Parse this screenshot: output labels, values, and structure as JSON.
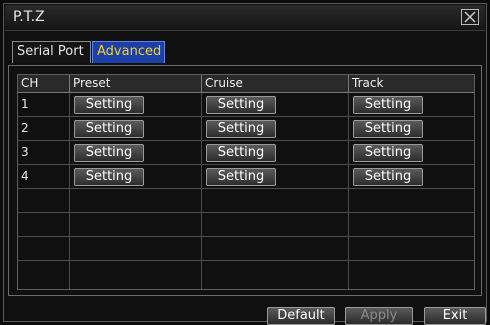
{
  "window": {
    "title": "P.T.Z"
  },
  "tabs": [
    {
      "label": "Serial Port",
      "active": false
    },
    {
      "label": "Advanced",
      "active": true
    }
  ],
  "table": {
    "headers": [
      "CH",
      "Preset",
      "Cruise",
      "Track"
    ],
    "rows": [
      {
        "ch": "1",
        "preset": "Setting",
        "cruise": "Setting",
        "track": "Setting"
      },
      {
        "ch": "2",
        "preset": "Setting",
        "cruise": "Setting",
        "track": "Setting"
      },
      {
        "ch": "3",
        "preset": "Setting",
        "cruise": "Setting",
        "track": "Setting"
      },
      {
        "ch": "4",
        "preset": "Setting",
        "cruise": "Setting",
        "track": "Setting"
      }
    ]
  },
  "footer": {
    "default": "Default",
    "apply": "Apply",
    "exit": "Exit"
  },
  "colors": {
    "active_tab_bg": "#1c3fa8",
    "active_tab_text": "#f5d320",
    "disabled_text": "#8a8a8a"
  },
  "icons": {
    "close": "close-icon"
  }
}
